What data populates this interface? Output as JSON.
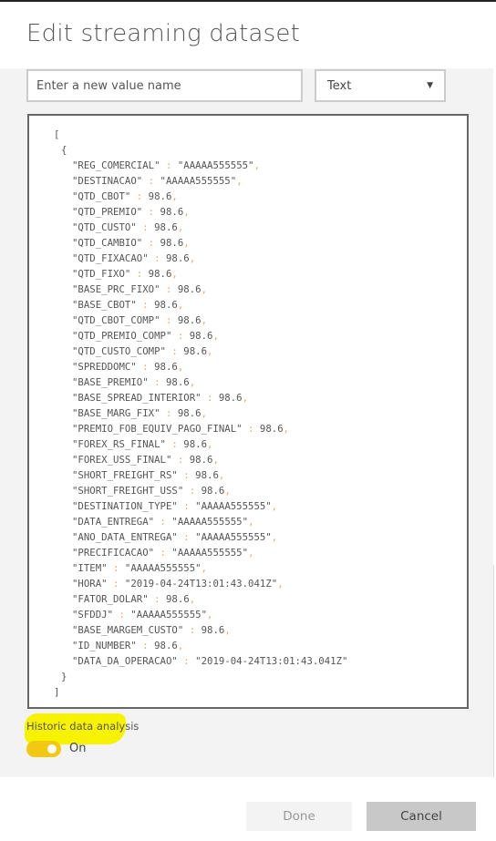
{
  "dialog": {
    "title": "Edit streaming dataset"
  },
  "value_name": {
    "placeholder": "Enter a new value name",
    "value": ""
  },
  "type_select": {
    "selected": "Text",
    "icon": "chevron-down-icon"
  },
  "json_editor": {
    "open_bracket": "[",
    "open_brace": "{",
    "fields": [
      [
        "\"REG_COMERCIAL\"",
        "\"AAAAA555555\""
      ],
      [
        "\"DESTINACAO\"",
        "\"AAAAA555555\""
      ],
      [
        "\"QTD_CBOT\"",
        "98.6"
      ],
      [
        "\"QTD_PREMIO\"",
        "98.6"
      ],
      [
        "\"QTD_CUSTO\"",
        "98.6"
      ],
      [
        "\"QTD_CAMBIO\"",
        "98.6"
      ],
      [
        "\"QTD_FIXACAO\"",
        "98.6"
      ],
      [
        "\"QTD_FIXO\"",
        "98.6"
      ],
      [
        "\"BASE_PRC_FIXO\"",
        "98.6"
      ],
      [
        "\"BASE_CBOT\"",
        "98.6"
      ],
      [
        "\"QTD_CBOT_COMP\"",
        "98.6"
      ],
      [
        "\"QTD_PREMIO_COMP\"",
        "98.6"
      ],
      [
        "\"QTD_CUSTO_COMP\"",
        "98.6"
      ],
      [
        "\"SPREDDOMC\"",
        "98.6"
      ],
      [
        "\"BASE_PREMIO\"",
        "98.6"
      ],
      [
        "\"BASE_SPREAD_INTERIOR\"",
        "98.6"
      ],
      [
        "\"BASE_MARG_FIX\"",
        "98.6"
      ],
      [
        "\"PREMIO_FOB_EQUIV_PAGO_FINAL\"",
        "98.6"
      ],
      [
        "\"FOREX_RS_FINAL\"",
        "98.6"
      ],
      [
        "\"FOREX_USS_FINAL\"",
        "98.6"
      ],
      [
        "\"SHORT_FREIGHT_RS\"",
        "98.6"
      ],
      [
        "\"SHORT_FREIGHT_USS\"",
        "98.6"
      ],
      [
        "\"DESTINATION_TYPE\"",
        "\"AAAAA555555\""
      ],
      [
        "\"DATA_ENTREGA\"",
        "\"AAAAA555555\""
      ],
      [
        "\"ANO_DATA_ENTREGA\"",
        "\"AAAAA555555\""
      ],
      [
        "\"PRECIFICACAO\"",
        "\"AAAAA555555\""
      ],
      [
        "\"ITEM\"",
        "\"AAAAA555555\""
      ],
      [
        "\"HORA\"",
        "\"2019-04-24T13:01:43.041Z\""
      ],
      [
        "\"FATOR_DOLAR\"",
        "98.6"
      ],
      [
        "\"SFDDJ\"",
        "\"AAAAA555555\""
      ],
      [
        "\"BASE_MARGEM_CUSTO\"",
        "98.6"
      ],
      [
        "\"ID_NUMBER\"",
        "98.6"
      ],
      [
        "\"DATA_DA_OPERACAO\"",
        "\"2019-04-24T13:01:43.041Z\""
      ]
    ],
    "separator": " : ",
    "comma": ",",
    "close_brace": "}",
    "close_bracket": "]"
  },
  "historic": {
    "label": "Historic data analysis",
    "toggle_state": "On",
    "enabled": true,
    "toggle_color": "#f2c811",
    "highlight_color": "#f6f200"
  },
  "footer": {
    "done_label": "Done",
    "cancel_label": "Cancel"
  }
}
